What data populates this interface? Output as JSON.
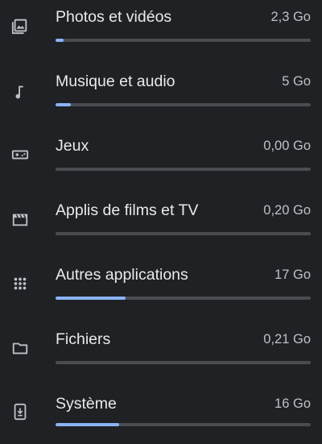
{
  "colors": {
    "background": "#202124",
    "label": "#e8eaed",
    "size": "#bdc1c6",
    "track": "#4a4c50",
    "fill": "#8ab4f8",
    "icon": "#bdc1c6"
  },
  "storage": {
    "items": [
      {
        "label": "Photos et vidéos",
        "size": "2,3 Go",
        "usage_fraction": 0.03,
        "icon": "photo-icon"
      },
      {
        "label": "Musique et audio",
        "size": "5 Go",
        "usage_fraction": 0.06,
        "icon": "music-note-icon"
      },
      {
        "label": "Jeux",
        "size": "0,00 Go",
        "usage_fraction": 0.0,
        "icon": "gamepad-icon"
      },
      {
        "label": "Applis de films et TV",
        "size": "0,20 Go",
        "usage_fraction": 0.0,
        "icon": "movie-icon"
      },
      {
        "label": "Autres applications",
        "size": "17 Go",
        "usage_fraction": 0.275,
        "icon": "apps-grid-icon"
      },
      {
        "label": "Fichiers",
        "size": "0,21 Go",
        "usage_fraction": 0.0,
        "icon": "folder-icon"
      },
      {
        "label": "Système",
        "size": "16 Go",
        "usage_fraction": 0.25,
        "icon": "system-update-icon"
      }
    ]
  }
}
